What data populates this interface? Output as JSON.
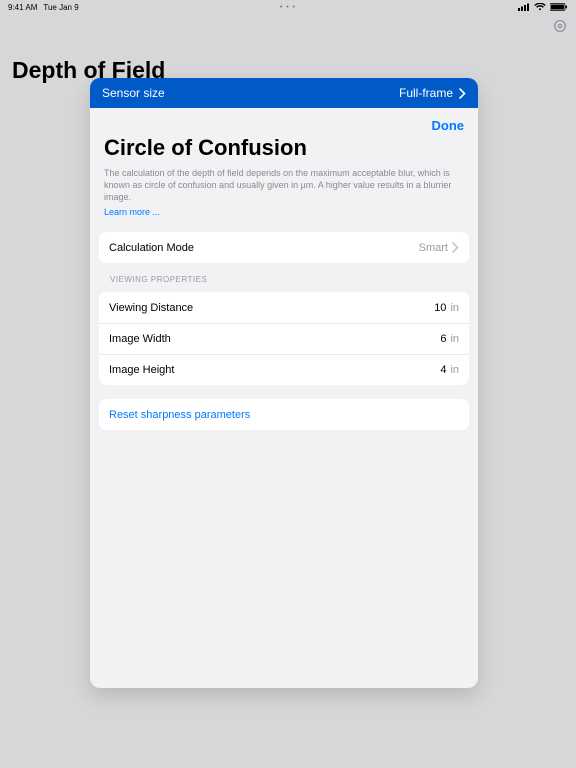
{
  "status": {
    "time": "9:41 AM",
    "date": "Tue Jan 9",
    "dots": "• • •"
  },
  "page_title": "Depth of Field",
  "sheet_header": {
    "label": "Sensor size",
    "value": "Full-frame"
  },
  "modal": {
    "done": "Done",
    "title": "Circle of Confusion",
    "desc": "The calculation of the depth of field depends on the maximum acceptable blur, which is known as circle of confusion and usually given in µm. A higher value results in a blurrier image.",
    "learn": "Learn more ..."
  },
  "calc": {
    "label": "Calculation Mode",
    "value": "Smart"
  },
  "viewing_section_label": "VIEWING PROPERTIES",
  "viewing": [
    {
      "label": "Viewing Distance",
      "value": "10",
      "unit": "in"
    },
    {
      "label": "Image Width",
      "value": "6",
      "unit": "in"
    },
    {
      "label": "Image Height",
      "value": "4",
      "unit": "in"
    }
  ],
  "reset": "Reset sharpness parameters"
}
